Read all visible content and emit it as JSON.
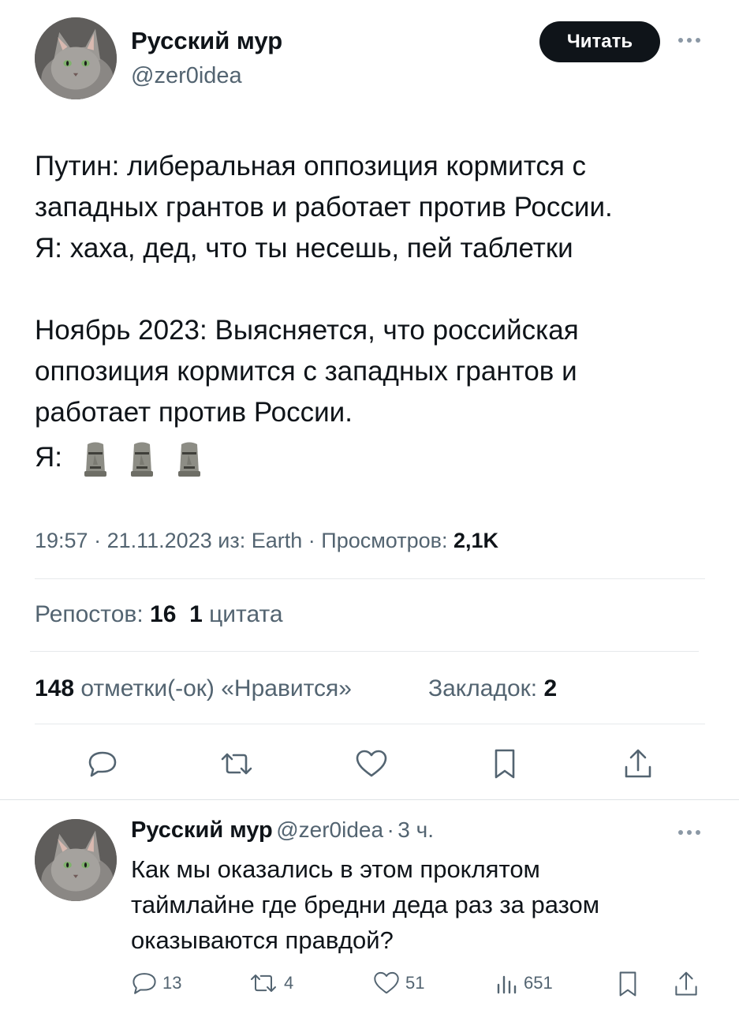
{
  "tweet": {
    "author_name": "Русский мур",
    "author_handle": "@zer0idea",
    "follow_label": "Читать",
    "text_lines": [
      "Путин: либеральная оппозиция кормится с",
      "западных грантов и работает против России.",
      "Я: хаха, дед, что ты несешь, пей таблетки",
      "Ноябрь 2023: Выясняется, что российская",
      "оппозиция кормится с западных грантов и",
      "работает против России.",
      "Я:"
    ],
    "emoji_name": "moai-emoji",
    "meta": {
      "time": "19:57",
      "date": "21.11.2023",
      "source_prefix": "из:",
      "source": "Earth",
      "views_label": "Просмотров:",
      "views": "2,1K"
    },
    "stats": {
      "reposts_label": "Репостов:",
      "reposts": "16",
      "quotes": "1",
      "quotes_label": "цитата",
      "likes": "148",
      "likes_label": "отметки(-ок) «Нравится»",
      "bookmarks_label": "Закладок:",
      "bookmarks": "2"
    },
    "actions": [
      "reply-icon",
      "repost-icon",
      "like-icon",
      "bookmark-icon",
      "share-icon"
    ]
  },
  "reply": {
    "author_name": "Русский мур",
    "author_handle": "@zer0idea",
    "time": "3 ч.",
    "text_lines": [
      "Как мы оказались в этом проклятом",
      "таймлайне где бредни деда раз за разом",
      "оказываются правдой?"
    ],
    "counts": {
      "replies": "13",
      "reposts": "4",
      "likes": "51",
      "views": "651"
    }
  },
  "colors": {
    "text": "#0f1419",
    "secondary": "#536471",
    "divider": "#e6e9ec",
    "button": "#0f1419"
  }
}
